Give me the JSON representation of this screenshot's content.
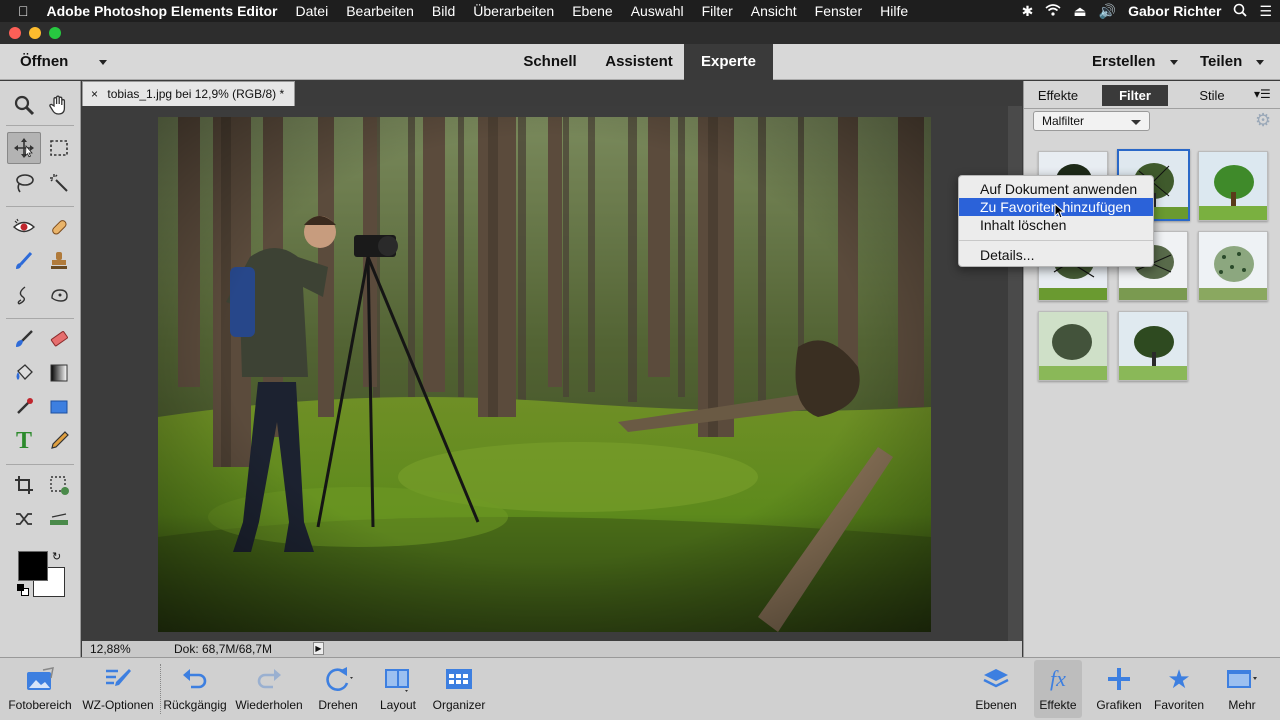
{
  "menubar": {
    "apple_icon": "apple-icon",
    "app_name": "Adobe Photoshop Elements Editor",
    "items": [
      "Datei",
      "Bearbeiten",
      "Bild",
      "Überarbeiten",
      "Ebene",
      "Auswahl",
      "Filter",
      "Ansicht",
      "Fenster",
      "Hilfe"
    ],
    "user": "Gabor Richter"
  },
  "modebar": {
    "open_label": "Öffnen",
    "modes": [
      "Schnell",
      "Assistent",
      "Experte"
    ],
    "active_mode": "Experte",
    "create_label": "Erstellen",
    "share_label": "Teilen"
  },
  "document": {
    "tab_title": "tobias_1.jpg bei 12,9% (RGB/8) *",
    "zoom": "12,88%",
    "doc_size": "Dok: 68,7M/68,7M"
  },
  "panel": {
    "tabs": [
      "Effekte",
      "Filter",
      "Stile"
    ],
    "active_tab": "Filter",
    "category": "Malfilter"
  },
  "context_menu": {
    "items": [
      "Auf Dokument anwenden",
      "Zu Favoriten hinzufügen",
      "Inhalt löschen",
      "Details..."
    ],
    "highlighted": "Zu Favoriten hinzufügen"
  },
  "bottombar": {
    "left": [
      "Fotobereich",
      "WZ-Optionen",
      "Rückgängig",
      "Wiederholen",
      "Drehen",
      "Layout",
      "Organizer"
    ],
    "right": [
      "Ebenen",
      "Effekte",
      "Grafiken",
      "Favoriten",
      "Mehr"
    ]
  },
  "colors": {
    "accent": "#2b62d9",
    "foreground_swatch": "#000000",
    "background_swatch": "#ffffff"
  }
}
